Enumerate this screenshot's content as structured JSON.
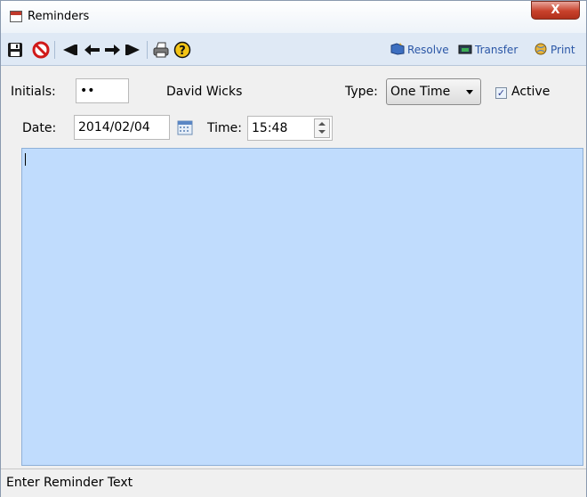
{
  "window": {
    "title": "Reminders",
    "close_label": "X"
  },
  "toolbar": {
    "left_icons": [
      "save-icon",
      "cancel-icon",
      "first-record-icon",
      "previous-record-icon",
      "next-record-icon",
      "last-record-icon",
      "print-icon",
      "help-icon"
    ],
    "resolve_label": "Resolve",
    "transfer_label": "Transfer",
    "print_label": "Print"
  },
  "form": {
    "initials_label": "Initials:",
    "initials_value": "••",
    "user_name": "David Wicks",
    "type_label": "Type:",
    "type_value": "One Time",
    "active_label": "Active",
    "active_checked": true,
    "date_label": "Date:",
    "date_value": "2014/02/04",
    "time_label": "Time:",
    "time_value": "15:48"
  },
  "reminder_text": "",
  "status": {
    "text": "Enter Reminder Text"
  },
  "colors": {
    "toolbar_bg": "#dfe9f5",
    "textarea_bg": "#c0dcfd",
    "link_blue": "#2a56a6"
  }
}
